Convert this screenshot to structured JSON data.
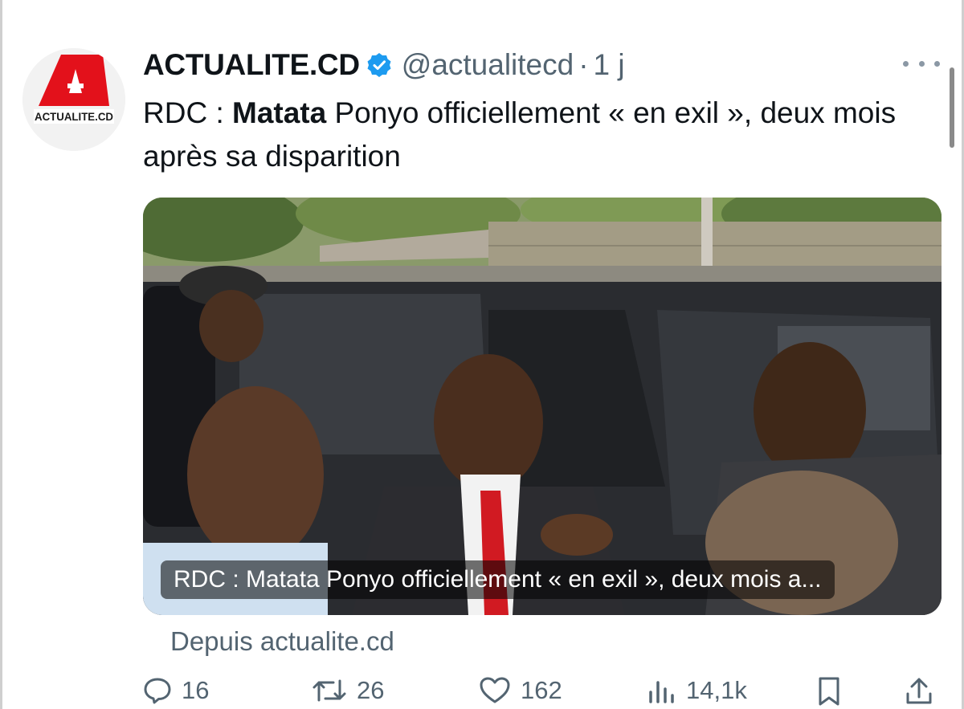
{
  "tweet": {
    "display_name": "ACTUALITE.CD",
    "handle": "@actualitecd",
    "separator": "·",
    "time": "1 j",
    "avatar_logo_text": "ACTUALITE.CD",
    "avatar_logo_letter": "A",
    "text_prefix": "RDC : ",
    "text_bold": "Matata",
    "text_rest": " Ponyo officiellement « en exil », deux mois après sa disparition",
    "card_caption": "RDC : Matata Ponyo officiellement « en exil », deux mois a...",
    "source": "Depuis actualite.cd",
    "brand_color": "#e3111b",
    "verified_color": "#1d9bf0"
  },
  "actions": {
    "reply_count": "16",
    "retweet_count": "26",
    "like_count": "162",
    "views_count": "14,1k",
    "icons": [
      "reply-icon",
      "retweet-icon",
      "like-icon",
      "views-icon",
      "bookmark-icon",
      "share-icon"
    ]
  }
}
